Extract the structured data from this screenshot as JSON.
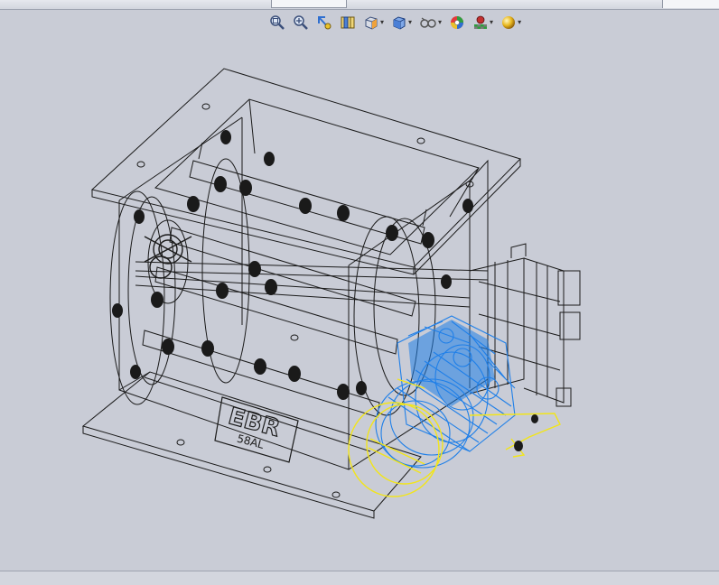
{
  "toolbar": {
    "items": [
      {
        "icon": "zoom-to-fit-icon",
        "has_dropdown": false
      },
      {
        "icon": "zoom-to-area-icon",
        "has_dropdown": false
      },
      {
        "icon": "previous-view-icon",
        "has_dropdown": false
      },
      {
        "icon": "section-view-icon",
        "has_dropdown": false
      },
      {
        "icon": "view-orientation-icon",
        "has_dropdown": true
      },
      {
        "icon": "display-style-icon",
        "has_dropdown": true
      },
      {
        "icon": "hide-show-items-icon",
        "has_dropdown": true
      },
      {
        "icon": "edit-appearance-icon",
        "has_dropdown": false
      },
      {
        "icon": "apply-scene-icon",
        "has_dropdown": true
      },
      {
        "icon": "view-settings-icon",
        "has_dropdown": true
      }
    ]
  },
  "model": {
    "nameplate_brand": "EBR",
    "nameplate_model": "58AL",
    "colors": {
      "background": "#c9ccd6",
      "wireframe": "#1a1a1a",
      "selected_component": "#1f7fe8",
      "highlight": "#f2e51a"
    }
  }
}
